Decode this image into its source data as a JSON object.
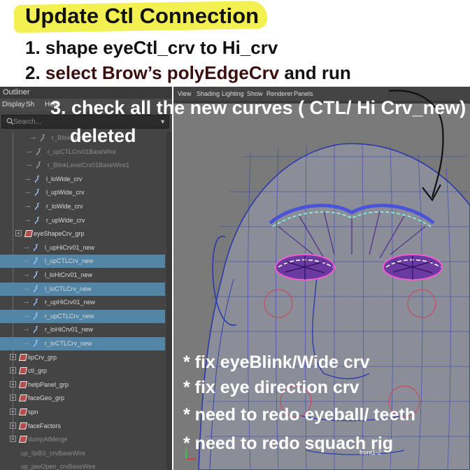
{
  "notes": {
    "title": "Update Ctl Connection",
    "line1": "1. shape eyeCtl_crv to Hi_crv",
    "line2_prefix": "2. ",
    "line2_highlight": "select Brow’s polyEdgeCrv",
    "line2_suffix": " and run",
    "line3a": "3. check all the new curves ( CTL/ Hi Crv_new)",
    "line3b": "deleted",
    "bullets": [
      "* fix eyeBlink/Wide crv",
      "* fix eye direction crv",
      "* need to redo eyeball/ teeth",
      "* need to redo squach rig"
    ]
  },
  "outliner": {
    "tab": "Outliner",
    "menu": [
      "Display",
      "Sh",
      "Help"
    ],
    "search_placeholder": "Search...",
    "items": [
      {
        "label": "r_BlinkLevelCrv"
      },
      {
        "label": "r_upCTLCrv01BaseWire"
      },
      {
        "label": "r_BlinkLevelCrv01BaseWire1"
      },
      {
        "label": "l_loWide_crv"
      },
      {
        "label": "l_upWide_crv"
      },
      {
        "label": "r_loWide_crv"
      },
      {
        "label": "r_upWide_crv"
      },
      {
        "label": "eyeShapeCrv_grp"
      },
      {
        "label": "l_upHiCrv01_new"
      },
      {
        "label": "l_upCTLCrv_new"
      },
      {
        "label": "l_loHiCrv01_new"
      },
      {
        "label": "l_loCTLCrv_new"
      },
      {
        "label": "r_upHiCrv01_new"
      },
      {
        "label": "r_upCTLCrv_new"
      },
      {
        "label": "r_loHiCrv01_new"
      },
      {
        "label": "r_loCTLCrv_new"
      },
      {
        "label": "lipCrv_grp"
      },
      {
        "label": "ctl_grp"
      },
      {
        "label": "helpPanel_grp"
      },
      {
        "label": "faceGeo_grp"
      },
      {
        "label": "spn"
      },
      {
        "label": "faceFactors"
      },
      {
        "label": "dumpAtMerge"
      },
      {
        "label": "up_lipBS_crvBaseWire"
      },
      {
        "label": "up_jawOpen_crvBaseWire"
      }
    ]
  },
  "viewport": {
    "menu": [
      "View",
      "Shading",
      "Lighting",
      "Show",
      "Renderer",
      "Panels"
    ],
    "camera_label": "front1-Z"
  }
}
